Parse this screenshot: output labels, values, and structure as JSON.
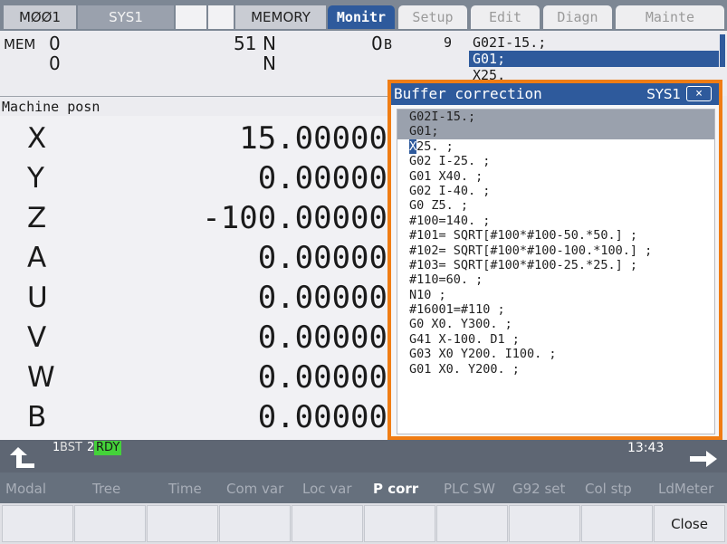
{
  "top_tabs": {
    "status": "MØØ1",
    "sys": "SYS1",
    "memory": "MEMORY",
    "menus": [
      "Monitr",
      "Setup",
      "Edit",
      "Diagn",
      "Mainte"
    ],
    "active_menu": "Monitr"
  },
  "header": {
    "mode": "MEM",
    "a1": "0",
    "a2": "0",
    "o_value": "51",
    "n_label_1": "N",
    "n_label_2": "N",
    "n_value": "0",
    "b_label": "B",
    "b_value": "9",
    "prog_line_1": "G02I-15.;",
    "prog_line_2": "G01;",
    "prog_line_3": "X25."
  },
  "machine_posn": {
    "title": "Machine posn",
    "axes": [
      {
        "name": "X",
        "value": "15.00000"
      },
      {
        "name": "Y",
        "value": "0.00000"
      },
      {
        "name": "Z",
        "value": "-100.00000"
      },
      {
        "name": "A",
        "value": "0.00000"
      },
      {
        "name": "U",
        "value": "0.00000"
      },
      {
        "name": "V",
        "value": "0.00000"
      },
      {
        "name": "W",
        "value": "0.00000"
      },
      {
        "name": "B",
        "value": "0.00000"
      }
    ]
  },
  "popup": {
    "title": "Buffer correction",
    "sys": "SYS1",
    "close_glyph": "×",
    "lines": [
      "G02I-15.;",
      "G01;",
      "X25. ;",
      "G02 I-25. ;",
      "G01 X40. ;",
      "G02 I-40. ;",
      "G0 Z5. ;",
      "#100=140. ;",
      "#101= SQRT[#100*#100-50.*50.] ;",
      "#102= SQRT[#100*#100-100.*100.] ;",
      "#103= SQRT[#100*#100-25.*25.] ;",
      "#110=60. ;",
      "N10 ;",
      "#16001=#110 ;",
      "G0 X0. Y300. ;",
      "G41 X-100. D1 ;",
      "G03 X0 Y200. I100. ;",
      "G01 X0. Y200. ;"
    ]
  },
  "status_bar": {
    "bst_num": "1",
    "bst": "BST",
    "rdy_num": "2",
    "rdy": "RDY",
    "time": "13:43",
    "rdy_color": "#44d23a"
  },
  "softkeys": {
    "labels": [
      "Modal",
      "Tree",
      "Time",
      "Com var",
      "Loc var",
      "P corr",
      "PLC SW",
      "G92 set",
      "Col stp",
      "LdMeter"
    ],
    "active": "P corr",
    "buttons": [
      "",
      "",
      "",
      "",
      "",
      "",
      "",
      "",
      "",
      "Close"
    ]
  },
  "icons": {
    "back": "return-arrow-icon",
    "next": "right-arrow-icon"
  }
}
